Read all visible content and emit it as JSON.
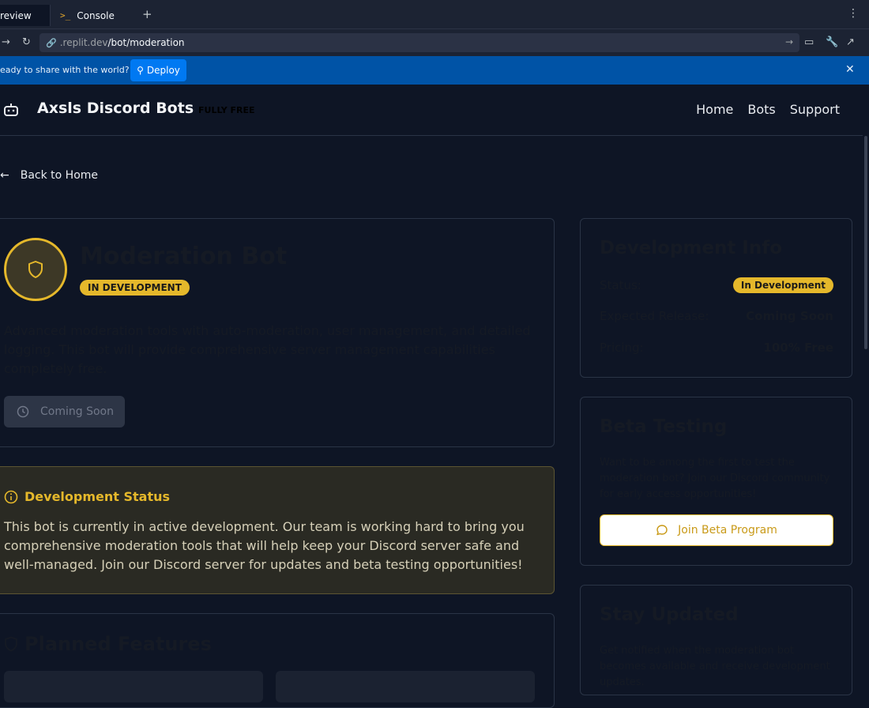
{
  "browser": {
    "tabs": [
      {
        "label": "review"
      },
      {
        "label": "Console"
      }
    ],
    "url_host": ".replit.dev",
    "url_path": "/bot/moderation"
  },
  "banner": {
    "text": "eady to share with the world?",
    "deploy_label": "Deploy"
  },
  "header": {
    "brand": "Axsls Discord Bots",
    "tag": "FULLY FREE",
    "nav": [
      "Home",
      "Bots",
      "Support"
    ]
  },
  "back_link": "Back to Home",
  "bot": {
    "title": "Moderation Bot",
    "badge": "IN DEVELOPMENT",
    "description": "Advanced moderation tools with auto-moderation, user management, and detailed logging. This bot will provide comprehensive server management capabilities completely free.",
    "action_label": "Coming Soon"
  },
  "dev_status": {
    "heading": "Development Status",
    "body": "This bot is currently in active development. Our team is working hard to bring you comprehensive moderation tools that will help keep your Discord server safe and well-managed. Join our Discord server for updates and beta testing opportunities!"
  },
  "features": {
    "heading": "Planned Features"
  },
  "dev_info": {
    "title": "Development Info",
    "rows": [
      {
        "label": "Status:",
        "value": "In Development"
      },
      {
        "label": "Expected Release:",
        "value": "Coming Soon"
      },
      {
        "label": "Pricing:",
        "value": "100% Free"
      }
    ]
  },
  "beta": {
    "title": "Beta Testing",
    "text": "Want to be among the first to test the moderation bot? Join our Discord community for early access opportunities!",
    "button": "Join Beta Program"
  },
  "updates": {
    "title": "Stay Updated",
    "text": "Get notified when the moderation bot becomes available and receive development updates."
  },
  "colors": {
    "accent": "#e5b82b",
    "background": "#0e1525",
    "banner": "#0053a6"
  }
}
